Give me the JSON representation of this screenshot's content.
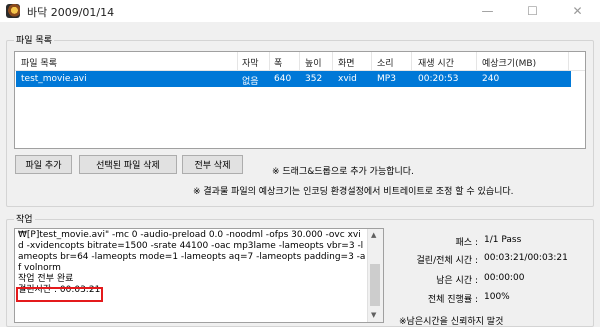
{
  "window": {
    "title": "바닥 2009/01/14",
    "minimize": "—",
    "maximize": "☐",
    "close": "✕"
  },
  "file_list": {
    "group_label": "파일 목록",
    "columns": [
      "파일 목록",
      "자막",
      "폭",
      "높이",
      "화면",
      "소리",
      "재생 시간",
      "예상크기(MB)"
    ],
    "rows": [
      {
        "name": "test_movie.avi",
        "subtitle": "없음",
        "width": "640",
        "height": "352",
        "video": "xvid",
        "audio": "MP3",
        "duration": "00:20:53",
        "size": "240"
      }
    ]
  },
  "buttons": {
    "add_file": "파일 추가",
    "delete_selected": "선택된 파일 삭제",
    "delete_all": "전부 삭제"
  },
  "notes": {
    "drag_drop": "※ 드래그&드롭으로 추가 가능합니다.",
    "size_note": "※ 결과물 파일의 예상크기는 인코딩 환경설정에서 비트레이트로 조정 할 수 있습니다."
  },
  "job": {
    "group_label": "작업",
    "log_lines": [
      "₩[P]test_movie.avi\" -mc 0 -audio-preload 0.0 -noodml -ofps 30.000 -ovc xvid -xvidencopts bitrate=1500 -srate 44100 -oac mp3lame -lameopts vbr=3 -lameopts br=64 -lameopts mode=1 -lameopts aq=7 -lameopts padding=3 -af volnorm",
      "작업 전부 완료",
      "걸린시간 : 00:03:21"
    ],
    "stats": {
      "pass_label": "패스 :",
      "pass_value": "1/1 Pass",
      "elapsed_label": "걸린/전체 시간 :",
      "elapsed_value": "00:03:21/00:03:21",
      "remaining_label": "남은 시간 :",
      "remaining_value": "00:00:00",
      "progress_label": "전체 진행률 :",
      "progress_value": "100%"
    },
    "footer_note": "※남은시간을 신뢰하지 말것"
  }
}
